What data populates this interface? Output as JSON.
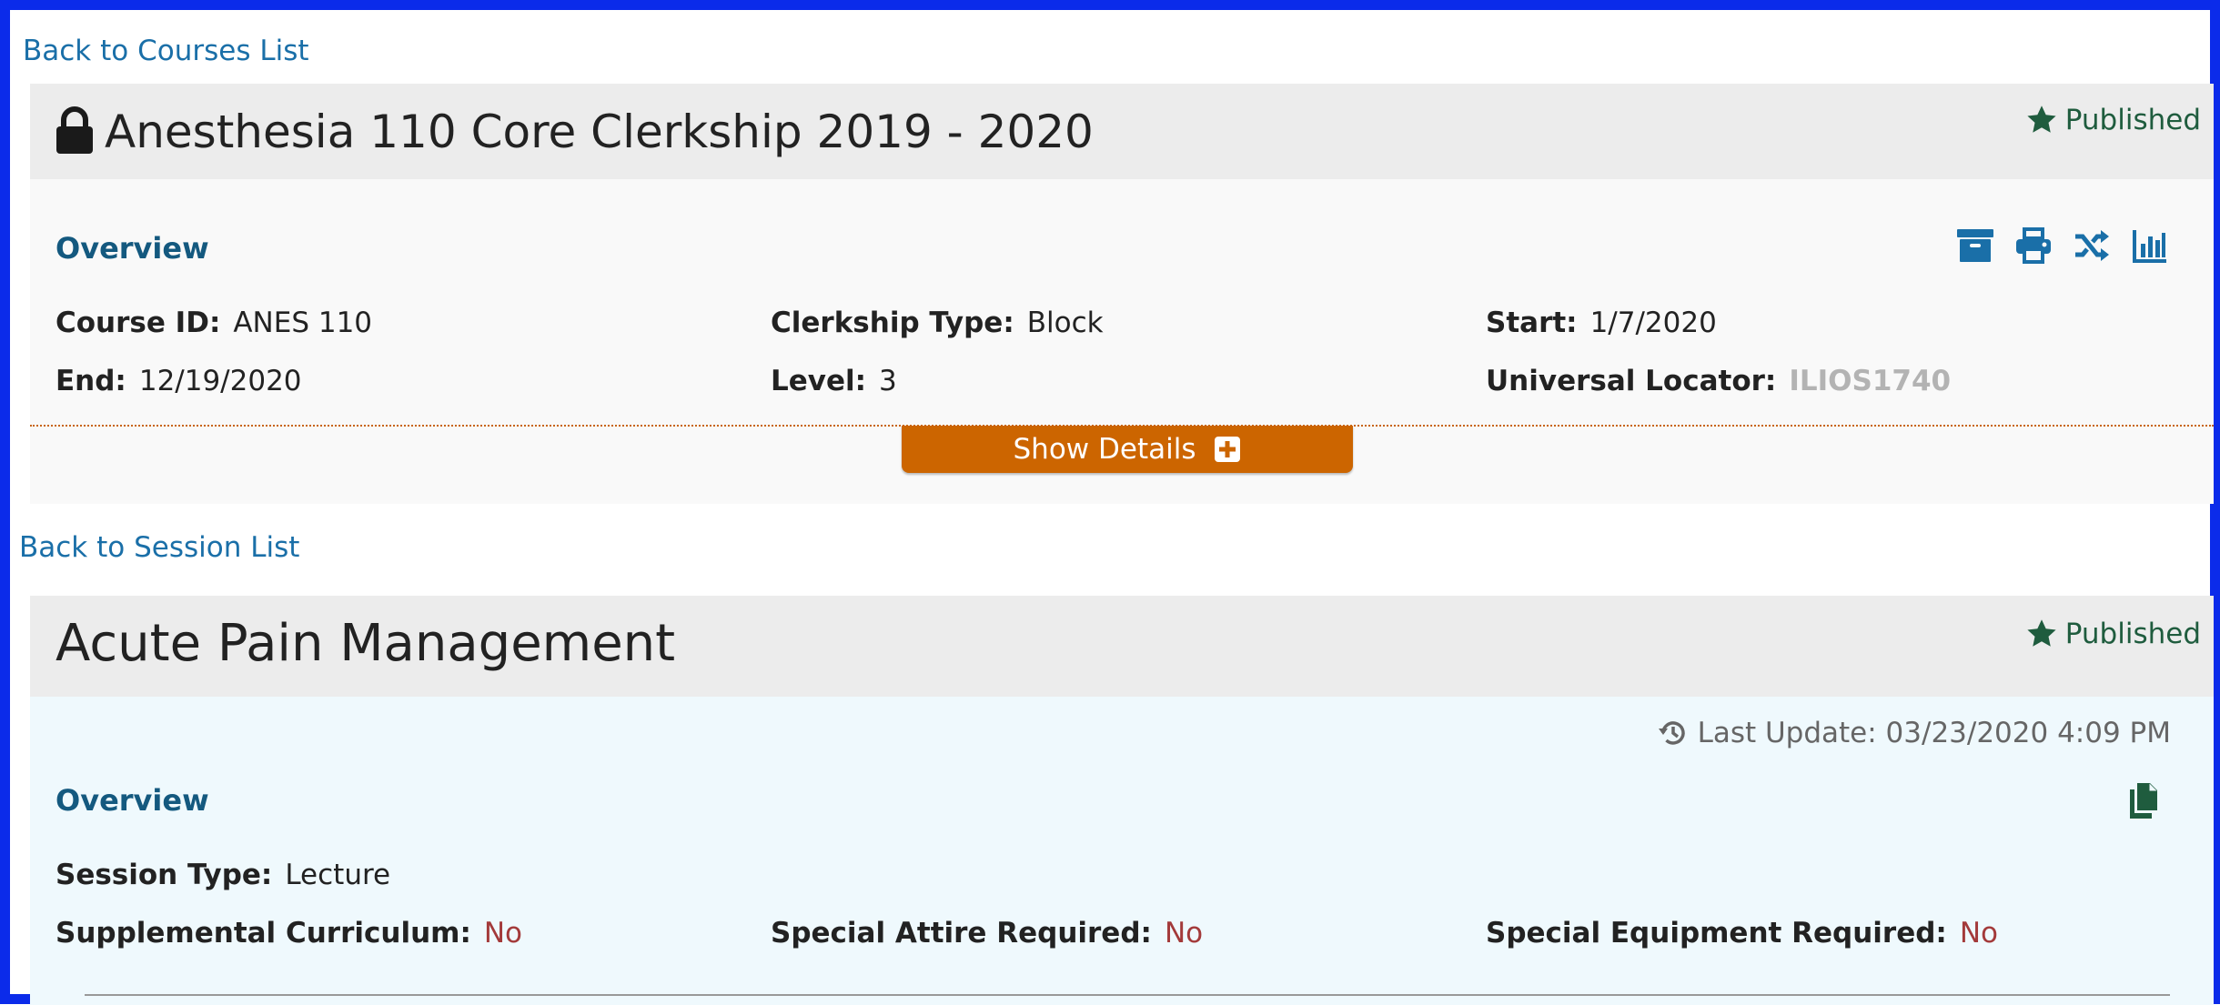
{
  "nav": {
    "back_to_courses": "Back to Courses List",
    "back_to_sessions": "Back to Session List"
  },
  "course": {
    "title": "Anesthesia 110 Core Clerkship 2019 - 2020",
    "status": "Published",
    "overview_label": "Overview",
    "tools": [
      "archive-icon",
      "print-icon",
      "rollover-icon",
      "visualize-icon"
    ],
    "fields": {
      "course_id": {
        "label": "Course ID:",
        "value": "ANES 110"
      },
      "clerkship_type": {
        "label": "Clerkship Type:",
        "value": "Block"
      },
      "start": {
        "label": "Start:",
        "value": "1/7/2020"
      },
      "end": {
        "label": "End:",
        "value": "12/19/2020"
      },
      "level": {
        "label": "Level:",
        "value": "3"
      },
      "universal_locator": {
        "label": "Universal Locator:",
        "value": "ILIOS1740"
      }
    },
    "show_details_label": "Show Details"
  },
  "session": {
    "title": "Acute Pain Management",
    "status": "Published",
    "last_update": "Last Update: 03/23/2020 4:09 PM",
    "overview_label": "Overview",
    "fields": {
      "session_type": {
        "label": "Session Type:",
        "value": "Lecture"
      },
      "supplemental": {
        "label": "Supplemental Curriculum:",
        "value": "No"
      },
      "special_attire": {
        "label": "Special Attire Required:",
        "value": "No"
      },
      "special_equipment": {
        "label": "Special Equipment Required:",
        "value": "No"
      }
    }
  },
  "colors": {
    "frame": "#0b2bea",
    "link": "#1a6fa8",
    "section_title": "#14597f",
    "published": "#1f5c3e",
    "show_details_bg": "#cc6500",
    "no_value": "#a33a3a",
    "locator_value": "#b3b3b3"
  }
}
